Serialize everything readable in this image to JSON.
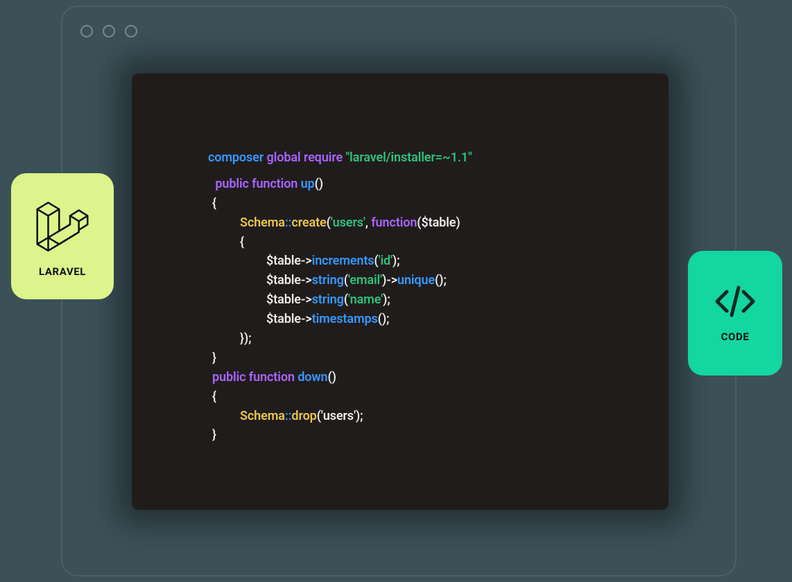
{
  "cards": {
    "laravel": {
      "label": "LARAVEL"
    },
    "code": {
      "label": "CODE"
    }
  },
  "code": {
    "composer": {
      "cmd": "composer",
      "sub": "global require",
      "arg": "\"laravel/installer=~1.1\""
    },
    "up": {
      "sig": {
        "kw": "public function",
        "name": "up",
        "parens": "()"
      },
      "openBrace": "{",
      "schemaCreate": {
        "cls": "Schema",
        "sep": "::",
        "method": "create",
        "openParen": "(",
        "arg": "'users'",
        "comma": ", ",
        "fnkw": "function",
        "fnargs": "($table)"
      },
      "innerOpenBrace": "{",
      "lines": [
        {
          "pre": "$table->",
          "method": "increments",
          "paren": "(",
          "arg": "'id'",
          "close": ");"
        },
        {
          "pre": "$table->",
          "method": "string",
          "paren": "(",
          "arg": "'email'",
          "close": ")->",
          "method2": "unique",
          "tail": "();"
        },
        {
          "pre": "$table->",
          "method": "string",
          "paren": "(",
          "arg": "'name'",
          "close": ");"
        },
        {
          "pre": "$table->",
          "method": "timestamps",
          "tail": "();"
        }
      ],
      "innerCloseBrace": "});",
      "closeBrace": "}"
    },
    "down": {
      "sig": {
        "kw": "public function",
        "name": "down",
        "parens": "()"
      },
      "openBrace": "{",
      "dropLine": {
        "cls": "Schema",
        "sep": "::",
        "method": "drop",
        "paren": "(",
        "arg": "'users'",
        "close": ");"
      },
      "closeBrace": "}"
    }
  }
}
